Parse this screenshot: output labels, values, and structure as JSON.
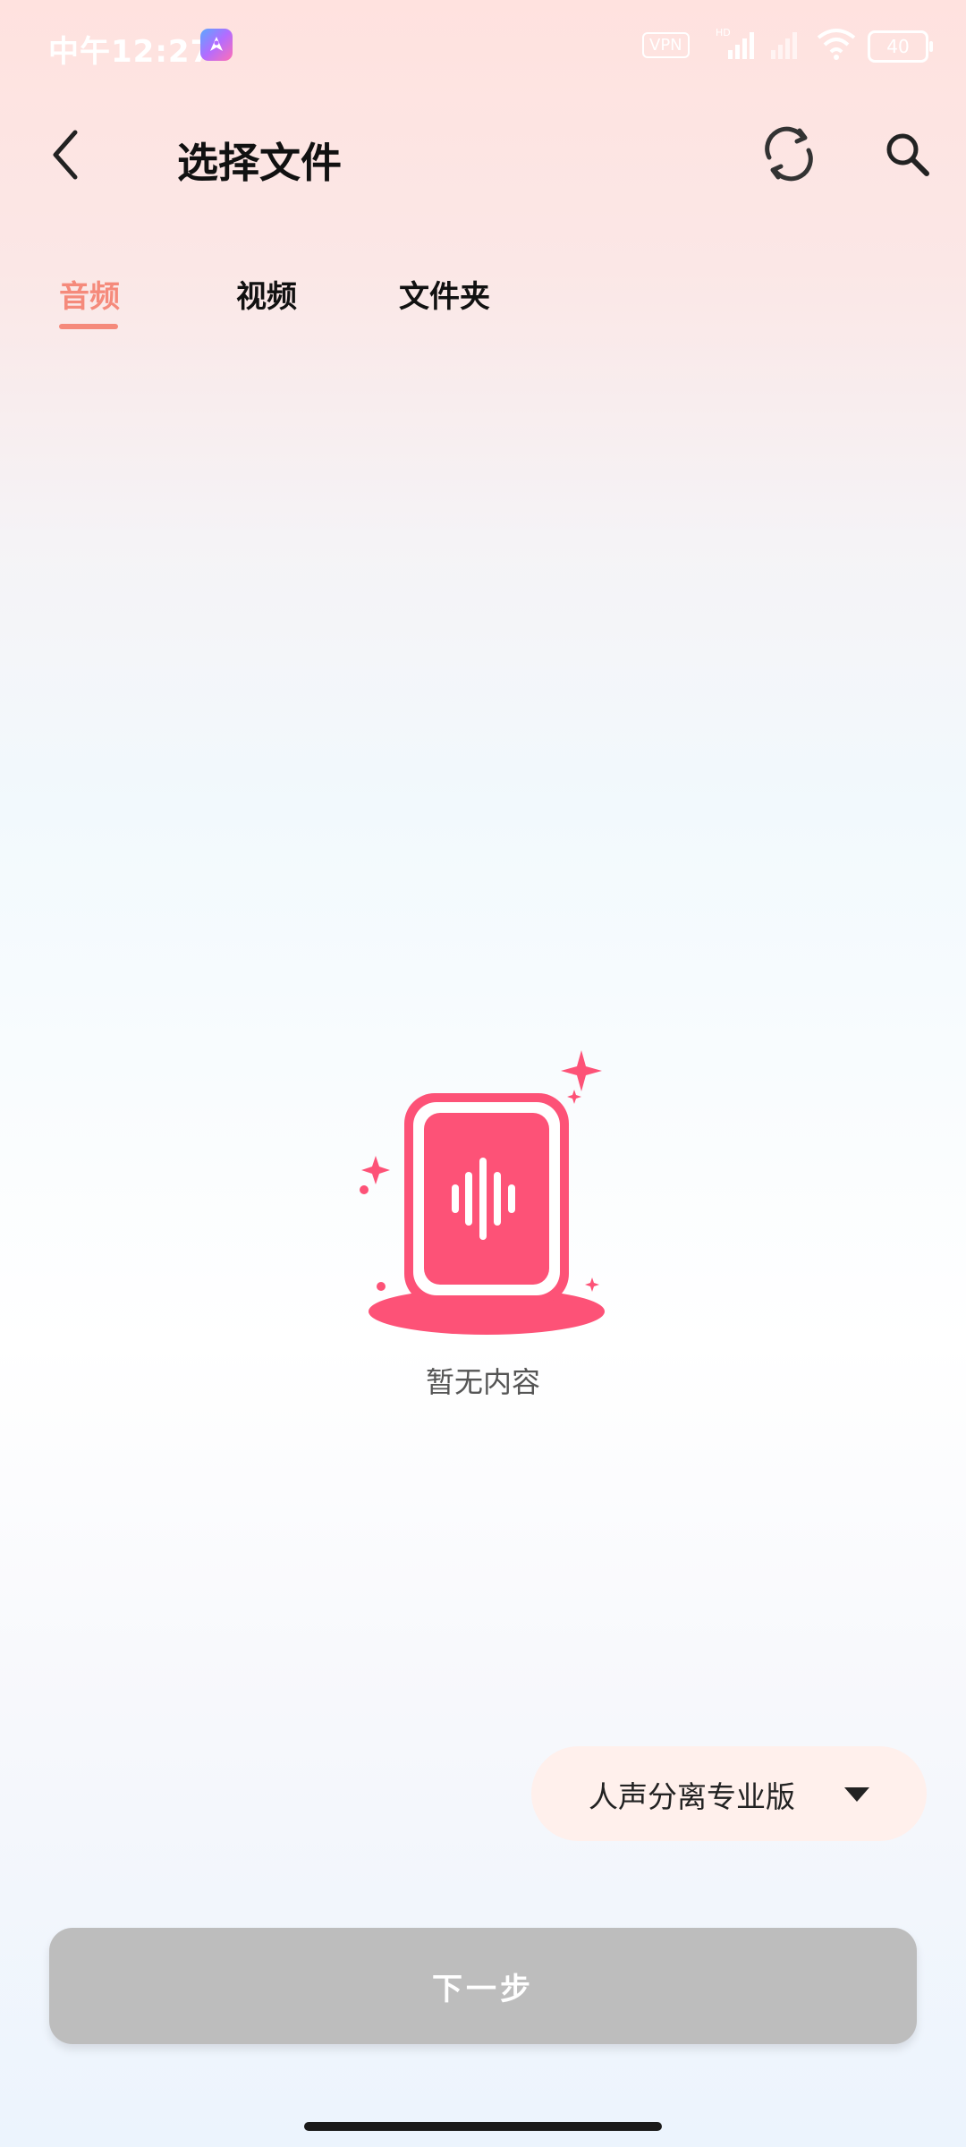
{
  "status_bar": {
    "time": "中午12:27",
    "vpn": "VPN",
    "network": "HD",
    "battery": "40"
  },
  "header": {
    "title": "选择文件"
  },
  "tabs": [
    {
      "label": "音频",
      "active": true
    },
    {
      "label": "视频",
      "active": false
    },
    {
      "label": "文件夹",
      "active": false
    }
  ],
  "empty_state": {
    "text": "暂无内容"
  },
  "mode_selector": {
    "label": "人声分离专业版"
  },
  "next_button": {
    "label": "下一步"
  },
  "colors": {
    "accent": "#f58a7b",
    "illustration": "#fd5277",
    "button_disabled": "#bdbdbd",
    "selector_bg": "#fff0ec"
  }
}
